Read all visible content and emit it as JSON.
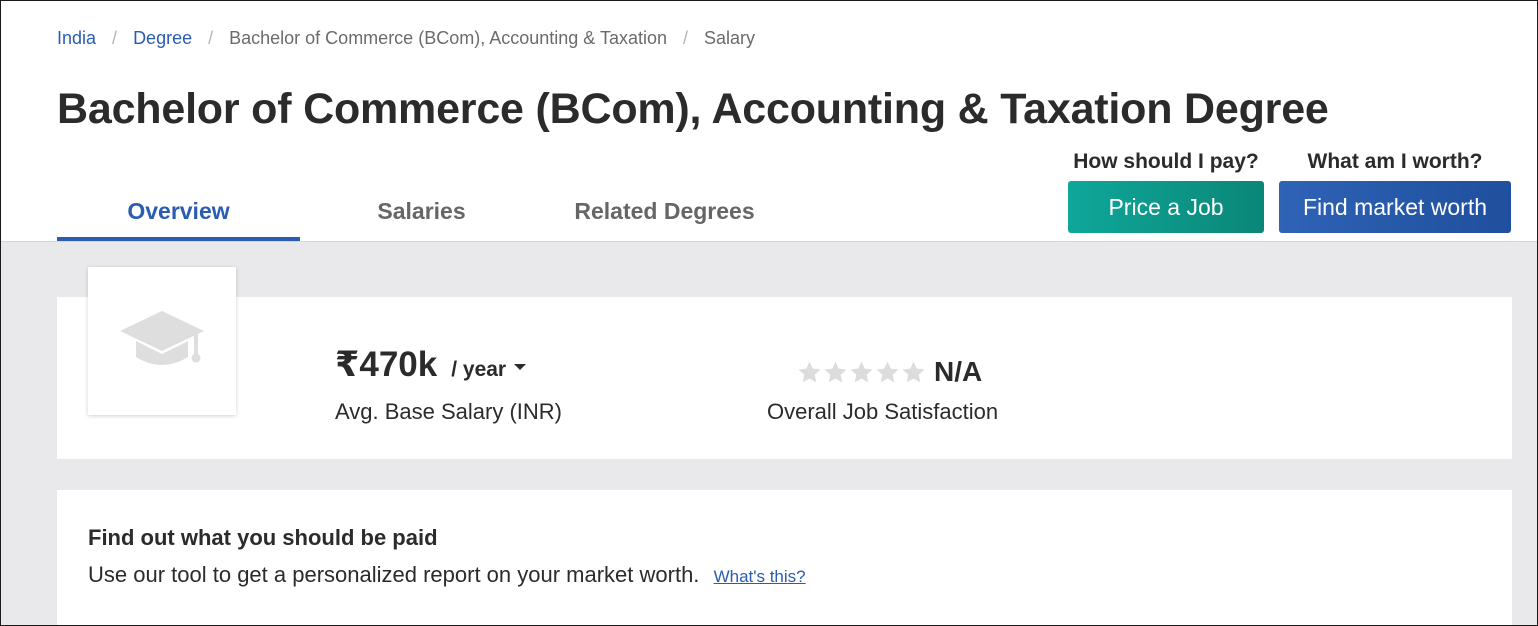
{
  "breadcrumb": {
    "items": [
      {
        "label": "India"
      },
      {
        "label": "Degree"
      },
      {
        "label": "Bachelor of Commerce (BCom), Accounting & Taxation"
      },
      {
        "label": "Salary"
      }
    ],
    "separator": "/"
  },
  "page": {
    "title": "Bachelor of Commerce (BCom), Accounting & Taxation Degree"
  },
  "tabs": [
    {
      "label": "Overview",
      "active": true
    },
    {
      "label": "Salaries",
      "active": false
    },
    {
      "label": "Related Degrees",
      "active": false
    }
  ],
  "cta": {
    "pay": {
      "caption": "How should I pay?",
      "button": "Price a Job"
    },
    "worth": {
      "caption": "What am I worth?",
      "button": "Find market worth"
    }
  },
  "summary": {
    "logo_icon": "graduation-cap-icon",
    "salary_amount": "₹470k",
    "salary_period": "/ year",
    "salary_label": "Avg. Base Salary (INR)",
    "rating_stars_filled": 0,
    "rating_stars_total": 5,
    "rating_value": "N/A",
    "rating_label": "Overall Job Satisfaction"
  },
  "tool": {
    "title": "Find out what you should be paid",
    "description": "Use our tool to get a personalized report on your market worth.",
    "link": "What's this?"
  },
  "colors": {
    "link": "#2a5db0",
    "teal_button": "#0fa79a",
    "blue_button": "#2f63b6",
    "star_empty": "#dcdcdc",
    "background": "#e9e9ec"
  }
}
